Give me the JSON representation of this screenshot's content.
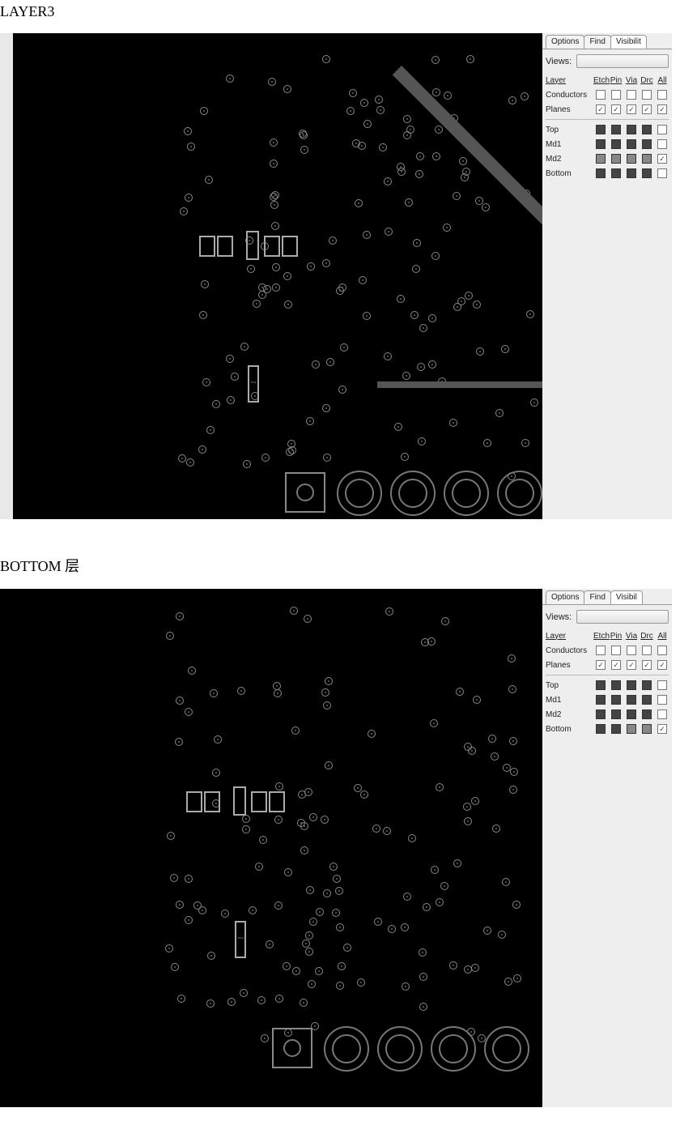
{
  "section1": {
    "title": "LAYER3"
  },
  "section2": {
    "title": "BOTTOM 层"
  },
  "panel1": {
    "tabs": {
      "options": "Options",
      "find": "Find",
      "visibility": "Visibilit"
    },
    "views_label": "Views:",
    "head": {
      "layer": "Layer",
      "etch": "Etch",
      "pin": "Pin",
      "via": "Via",
      "drc": "Drc",
      "all": "All"
    },
    "rows_meta": [
      {
        "label": "Conductors"
      },
      {
        "label": "Planes"
      }
    ],
    "layer_rows": [
      {
        "label": "Top"
      },
      {
        "label": "Md1"
      },
      {
        "label": "Md2"
      },
      {
        "label": "Bottom"
      }
    ]
  },
  "panel2": {
    "tabs": {
      "options": "Options",
      "find": "Find",
      "visibility": "Visibil"
    },
    "views_label": "Views:",
    "head": {
      "layer": "Layer",
      "etch": "Etch",
      "pin": "Pin",
      "via": "Via",
      "drc": "Drc",
      "all": "All"
    },
    "rows_meta": [
      {
        "label": "Conductors"
      },
      {
        "label": "Planes"
      }
    ],
    "layer_rows": [
      {
        "label": "Top"
      },
      {
        "label": "Md1"
      },
      {
        "label": "Md2"
      },
      {
        "label": "Bottom"
      }
    ]
  }
}
